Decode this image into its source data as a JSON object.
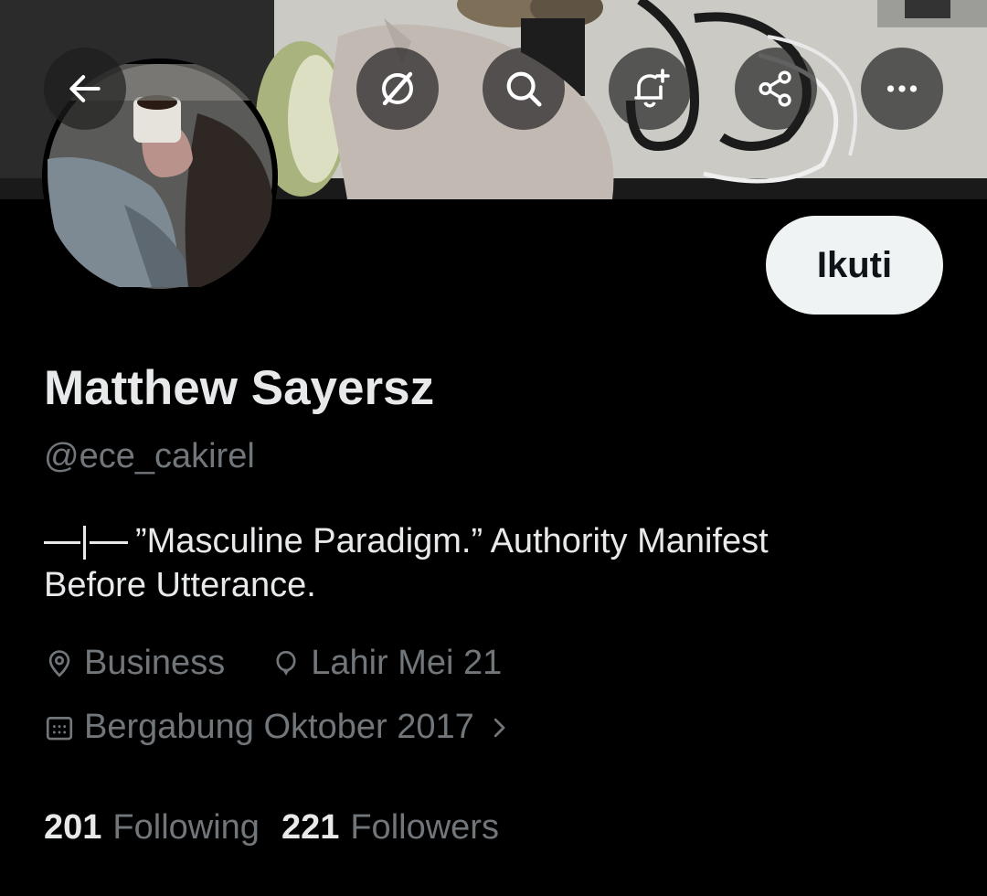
{
  "header": {
    "back_icon": "arrow-left-icon",
    "actions": [
      {
        "icon": "grok-icon"
      },
      {
        "icon": "search-icon"
      },
      {
        "icon": "bell-plus-icon"
      },
      {
        "icon": "share-icon"
      },
      {
        "icon": "more-icon"
      }
    ]
  },
  "profile": {
    "follow_label": "Ikuti",
    "display_name": "Matthew Sayersz",
    "handle": "@ece_cakirel",
    "bio_line1": "”Masculine Paradigm.” Authority Manifest",
    "bio_line2": "Before Utterance.",
    "category": "Business",
    "birthday": "Lahir Mei 21",
    "joined": "Bergabung Oktober 2017",
    "following_count": "201",
    "following_label": "Following",
    "followers_count": "221",
    "followers_label": "Followers"
  },
  "colors": {
    "background": "#000000",
    "primary_text": "#e7e9ea",
    "secondary_text": "#71767b",
    "follow_button_bg": "#eff3f4",
    "follow_button_text": "#0f1419"
  }
}
